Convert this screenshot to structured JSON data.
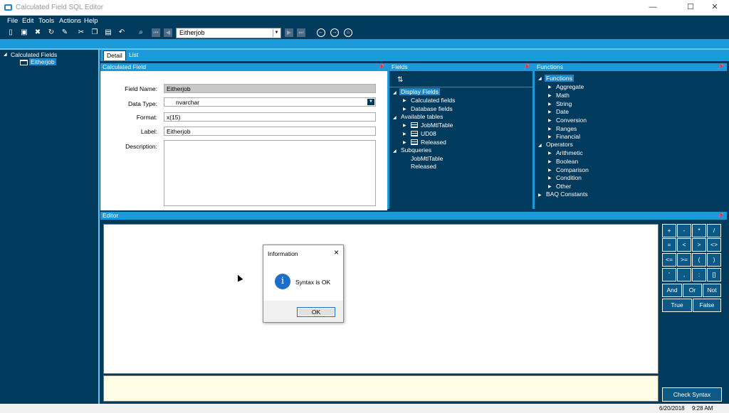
{
  "window": {
    "title": "Calculated Field SQL Editor",
    "minimize": "—",
    "maximize": "☐",
    "close": "✕"
  },
  "menu": [
    "File",
    "Edit",
    "Tools",
    "Actions",
    "Help"
  ],
  "toolbar": {
    "combo_value": "Eitherjob"
  },
  "left_tree": {
    "root": "Calculated Fields",
    "child": "Eitherjob"
  },
  "tabs": [
    "Detail",
    "List"
  ],
  "calc_panel": {
    "header": "Calculated Field",
    "field_name_label": "Field Name:",
    "field_name_value": "Eitherjob",
    "data_type_label": "Data Type:",
    "data_type_value": "nvarchar",
    "format_label": "Format:",
    "format_value": "x(15)",
    "label_label": "Label:",
    "label_value": "Eitherjob",
    "description_label": "Description:",
    "description_value": ""
  },
  "fields_panel": {
    "header": "Fields",
    "sort_icon": "⇅",
    "items": [
      "Display Fields",
      "Calculated fields",
      "Database fields",
      "Available tables",
      "JobMtlTable",
      "UD08",
      "Released",
      "Subqueries",
      "JobMtlTable",
      "Released"
    ]
  },
  "functions_panel": {
    "header": "Functions",
    "items": [
      "Functions",
      "Aggregate",
      "Math",
      "String",
      "Date",
      "Conversion",
      "Ranges",
      "Financial",
      "Operators",
      "Arithmetic",
      "Boolean",
      "Comparison",
      "Condition",
      "Other",
      "BAQ Constants"
    ]
  },
  "editor": {
    "header": "Editor",
    "content": ""
  },
  "operators": [
    [
      "+",
      "-",
      "*",
      "/"
    ],
    [
      "=",
      "<",
      ">",
      "<>"
    ],
    [
      "<=",
      ">=",
      "(",
      ")"
    ],
    [
      "'",
      ",",
      ":",
      "[]"
    ],
    [
      "And",
      "Or",
      "Not"
    ],
    [
      "True",
      "False"
    ]
  ],
  "check_syntax_label": "Check Syntax",
  "status": {
    "date": "6/20/2018",
    "time": "9:28 AM"
  },
  "dialog": {
    "title": "Information",
    "message": "Syntax is OK",
    "ok_label": "OK",
    "icon": "i"
  },
  "colors": {
    "dark_navy": "#003a5c",
    "accent_blue": "#1a9ad8",
    "selection": "#1a86c8",
    "light_yellow": "#fffde6"
  }
}
